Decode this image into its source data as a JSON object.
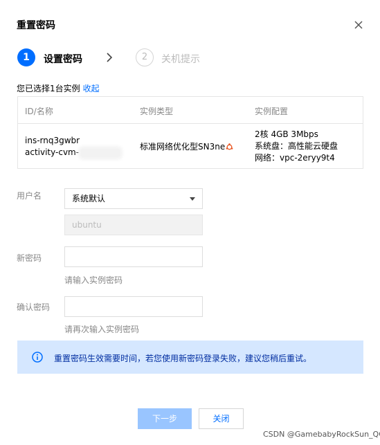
{
  "dialog": {
    "title": "重置密码",
    "close_icon": "close-icon"
  },
  "steps": [
    {
      "number": "1",
      "label": "设置密码",
      "state": "active"
    },
    {
      "number": "2",
      "label": "关机提示",
      "state": "inactive"
    }
  ],
  "selection": {
    "text": "您已选择1台实例",
    "collapse_label": "收起"
  },
  "table": {
    "headers": [
      "ID/名称",
      "实例类型",
      "实例配置"
    ],
    "row": {
      "id": "ins-rnq3gwbr",
      "name": "activity-cvm-",
      "type": "标准网络优化型SN3ne",
      "os_icon": "ubuntu-icon",
      "config_spec": "2核 4GB 3Mbps",
      "config_disk": "系统盘：高性能云硬盘",
      "config_network": "网络：vpc-2eryy9t4"
    }
  },
  "form": {
    "username_label": "用户名",
    "username_select_value": "系统默认",
    "username_value": "ubuntu",
    "new_password_label": "新密码",
    "new_password_value": "",
    "new_password_hint": "请输入实例密码",
    "confirm_password_label": "确认密码",
    "confirm_password_value": "",
    "confirm_password_hint": "请再次输入实例密码"
  },
  "notice": {
    "icon": "info-icon",
    "text": "重置密码生效需要时间，若您使用新密码登录失败，建议您稍后重试。"
  },
  "buttons": {
    "next_label": "下一步",
    "close_label": "关闭"
  },
  "watermark": "CSDN @GamebabyRockSun_QQ",
  "colors": {
    "accent": "#006eff",
    "disabled_button": "#99c5ff",
    "notice_background": "#d5e7ff",
    "notice_text": "#002da0",
    "ubuntu_orange": "#e95420"
  }
}
